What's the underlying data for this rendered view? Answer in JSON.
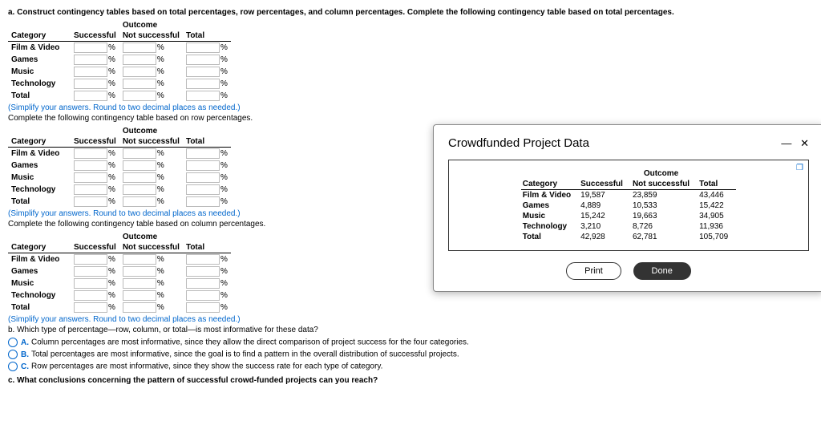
{
  "q_a": "a. Construct contingency tables based on total percentages, row percentages, and column percentages. Complete the following contingency table based on total percentages.",
  "q_row": "Complete the following contingency table based on row percentages.",
  "q_col": "Complete the following contingency table based on column percentages.",
  "q_b": "b. Which type of percentage—row, column, or total—is most informative for these data?",
  "q_c": "c. What conclusions concerning the pattern of successful crowd-funded projects can you reach?",
  "simplify": "(Simplify your answers. Round to two decimal places as needed.)",
  "headers": {
    "outcome": "Outcome",
    "category": "Category",
    "successful": "Successful",
    "not_successful": "Not successful",
    "total": "Total"
  },
  "rows": [
    "Film & Video",
    "Games",
    "Music",
    "Technology",
    "Total"
  ],
  "pct": "%",
  "options": {
    "A": "Column percentages are most informative, since they allow the direct comparison of project success for the four categories.",
    "B": "Total percentages are most informative, since the goal is to find a pattern in the overall distribution of successful projects.",
    "C": "Row percentages are most informative, since they show the success rate for each type of category."
  },
  "dialog": {
    "title": "Crowdfunded Project Data",
    "print": "Print",
    "done": "Done",
    "data": {
      "headers": [
        "Category",
        "Successful",
        "Not successful",
        "Total"
      ],
      "rows": [
        [
          "Film & Video",
          "19,587",
          "23,859",
          "43,446"
        ],
        [
          "Games",
          "4,889",
          "10,533",
          "15,422"
        ],
        [
          "Music",
          "15,242",
          "19,663",
          "34,905"
        ],
        [
          "Technology",
          "3,210",
          "8,726",
          "11,936"
        ],
        [
          "Total",
          "42,928",
          "62,781",
          "105,709"
        ]
      ]
    }
  },
  "chart_data": {
    "type": "table",
    "title": "Crowdfunded Project Data",
    "columns": [
      "Category",
      "Successful",
      "Not successful",
      "Total"
    ],
    "rows": [
      {
        "Category": "Film & Video",
        "Successful": 19587,
        "Not successful": 23859,
        "Total": 43446
      },
      {
        "Category": "Games",
        "Successful": 4889,
        "Not successful": 10533,
        "Total": 15422
      },
      {
        "Category": "Music",
        "Successful": 15242,
        "Not successful": 19663,
        "Total": 34905
      },
      {
        "Category": "Technology",
        "Successful": 3210,
        "Not successful": 8726,
        "Total": 11936
      },
      {
        "Category": "Total",
        "Successful": 42928,
        "Not successful": 62781,
        "Total": 105709
      }
    ]
  }
}
